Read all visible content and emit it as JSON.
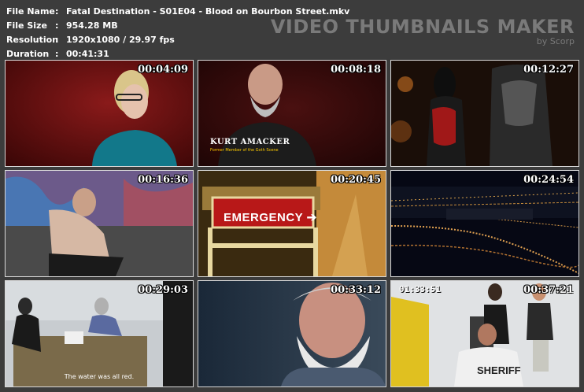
{
  "file_info": {
    "labels": [
      "File Name",
      "File Size",
      "Resolution",
      "Duration"
    ],
    "separator": ":",
    "file_name": "Fatal Destination - S01E04 - Blood on Bourbon Street.mkv",
    "file_size": "954.28 MB",
    "resolution": "1920x1080 / 29.97 fps",
    "duration": "00:41:31"
  },
  "brand": {
    "title": "VIDEO THUMBNAILS MAKER",
    "subtitle": "by Scorp"
  },
  "thumbnails": [
    {
      "timestamp": "00:04:09"
    },
    {
      "timestamp": "00:08:18",
      "caption_name": "KURT AMACKER",
      "caption_role": "Former Member of the Goth Scene"
    },
    {
      "timestamp": "00:12:27"
    },
    {
      "timestamp": "00:16:36"
    },
    {
      "timestamp": "00:20:45",
      "sign_text": "EMERGENCY ➔"
    },
    {
      "timestamp": "00:24:54"
    },
    {
      "timestamp": "00:29:03",
      "subtitle": "The water was all red."
    },
    {
      "timestamp": "00:33:12"
    },
    {
      "timestamp": "00:37:21",
      "cctv_clock": "01:33:51",
      "shirt_text": "SHERIFF"
    }
  ]
}
